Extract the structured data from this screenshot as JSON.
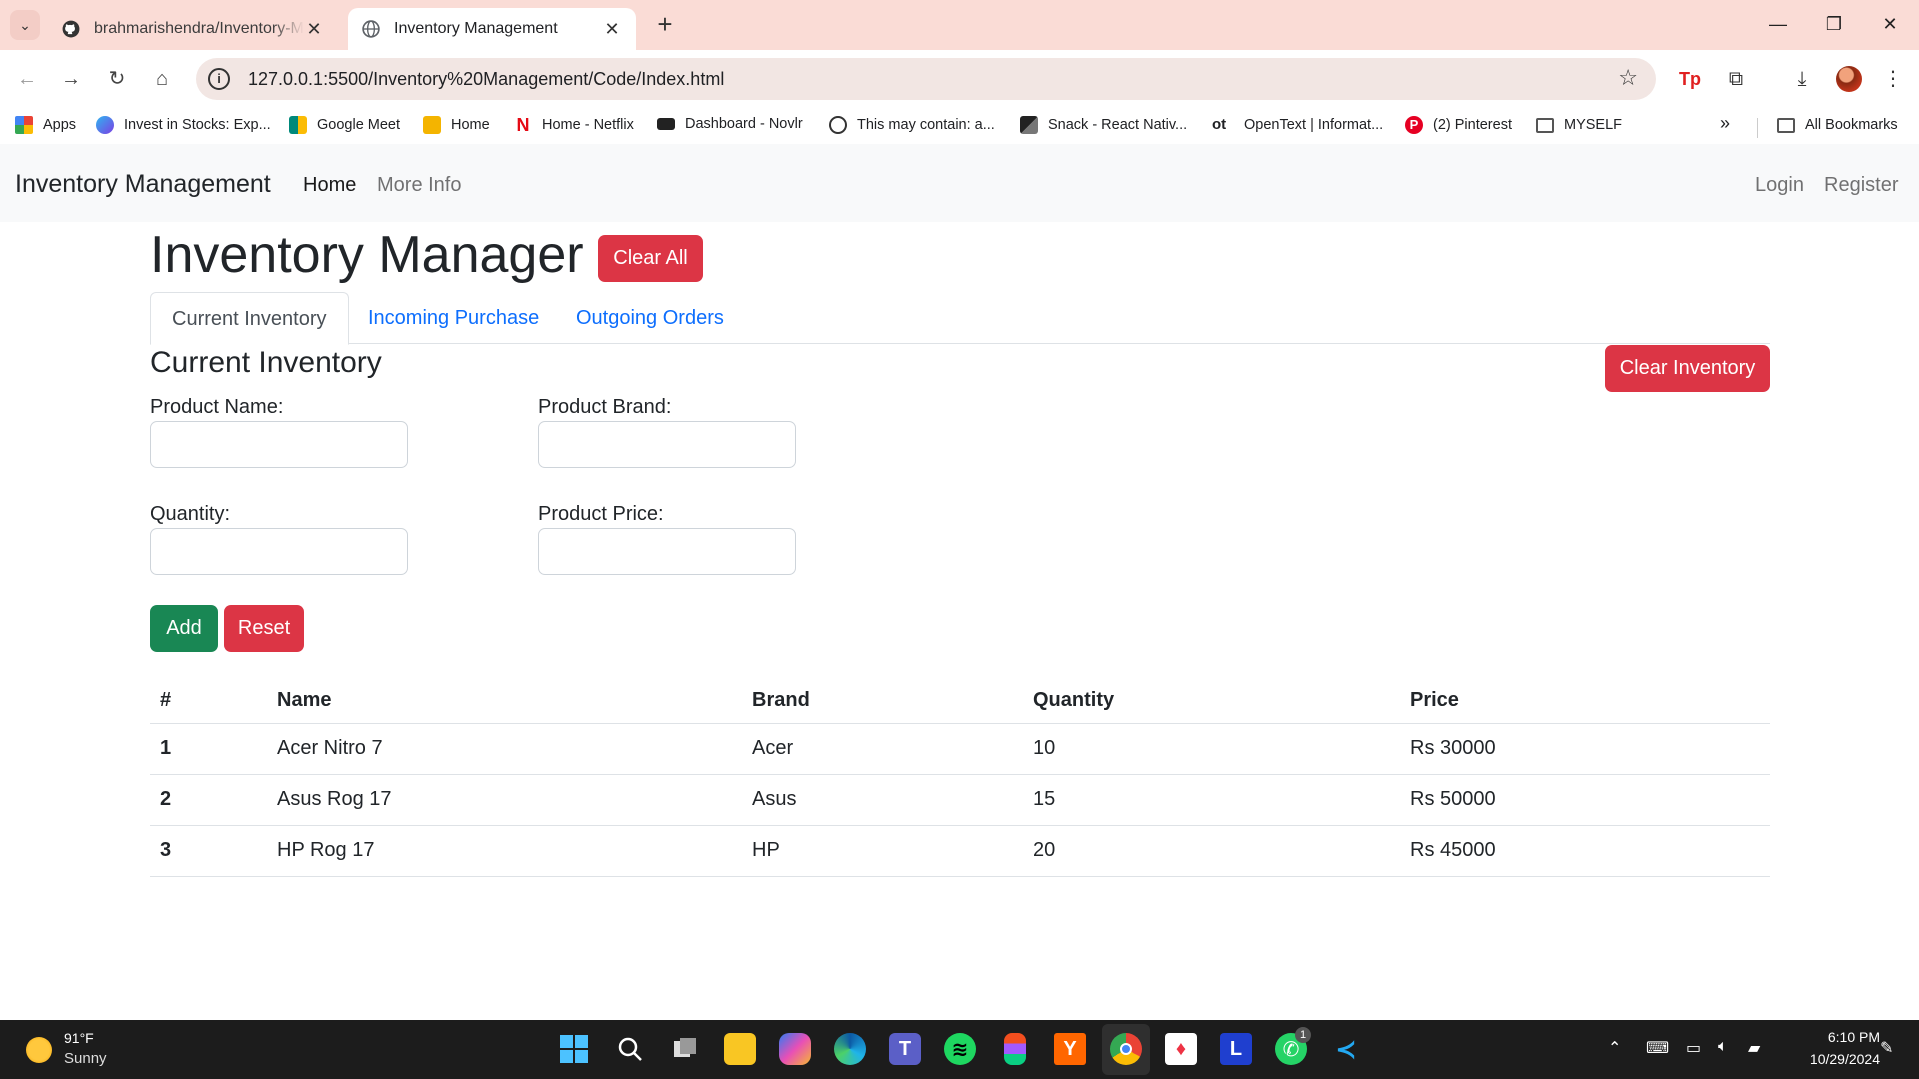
{
  "browser": {
    "tabs": [
      {
        "title": "brahmarishendra/Inventory-Management",
        "active": false
      },
      {
        "title": "Inventory Management",
        "active": true
      }
    ],
    "url": "127.0.0.1:5500/Inventory%20Management/Code/Index.html",
    "bookmarks": [
      {
        "label": "Apps",
        "icon": "apps-grid-icon",
        "color": "#4285f4"
      },
      {
        "label": "Invest in Stocks: Exp...",
        "icon": "invest-icon",
        "color": "#5a3fd6"
      },
      {
        "label": "Google Meet",
        "icon": "google-meet-icon",
        "color": "#00897b"
      },
      {
        "label": "Home",
        "icon": "home-folder-icon",
        "color": "#f4b400"
      },
      {
        "label": "Home - Netflix",
        "icon": "netflix-icon",
        "color": "#e50914"
      },
      {
        "label": "Dashboard - Novlr",
        "icon": "novlr-icon",
        "color": "#222222"
      },
      {
        "label": "This may contain: a...",
        "icon": "globe-icon",
        "color": "#333333"
      },
      {
        "label": "Snack - React Nativ...",
        "icon": "snack-icon",
        "color": "#222222"
      },
      {
        "label": "OpenText | Informat...",
        "icon": "opentext-icon",
        "color": "#111111"
      },
      {
        "label": "(2) Pinterest",
        "icon": "pinterest-icon",
        "color": "#e60023"
      },
      {
        "label": "MYSELF",
        "icon": "folder-icon",
        "color": "#555555"
      }
    ],
    "all_bookmarks": "All Bookmarks"
  },
  "navbar": {
    "brand": "Inventory Management",
    "links": [
      {
        "label": "Home",
        "active": true
      },
      {
        "label": "More Info",
        "active": false
      }
    ],
    "right_links": [
      "Login",
      "Register"
    ]
  },
  "main": {
    "title": "Inventory Manager",
    "clear_all_label": "Clear All",
    "tabs": [
      "Current Inventory",
      "Incoming Purchase",
      "Outgoing Orders"
    ],
    "section_title": "Current Inventory",
    "clear_inventory_label": "Clear Inventory",
    "form": {
      "product_name_label": "Product Name:",
      "product_brand_label": "Product Brand:",
      "quantity_label": "Quantity:",
      "product_price_label": "Product Price:",
      "product_name_value": "",
      "product_brand_value": "",
      "quantity_value": "",
      "product_price_value": "",
      "add_label": "Add",
      "reset_label": "Reset"
    },
    "table": {
      "headers": [
        "#",
        "Name",
        "Brand",
        "Quantity",
        "Price"
      ],
      "rows": [
        [
          "1",
          "Acer Nitro 7",
          "Acer",
          "10",
          "Rs 30000"
        ],
        [
          "2",
          "Asus Rog 17",
          "Asus",
          "15",
          "Rs 50000"
        ],
        [
          "3",
          "HP Rog 17",
          "HP",
          "20",
          "Rs 45000"
        ]
      ]
    }
  },
  "taskbar": {
    "weather_temp": "91°F",
    "weather_desc": "Sunny",
    "time": "6:10 PM",
    "date": "10/29/2024",
    "whatsapp_badge": "1"
  },
  "colors": {
    "danger": "#dc3545",
    "success": "#198754",
    "link": "#0d6efd",
    "tabstrip": "#fadcd6"
  }
}
